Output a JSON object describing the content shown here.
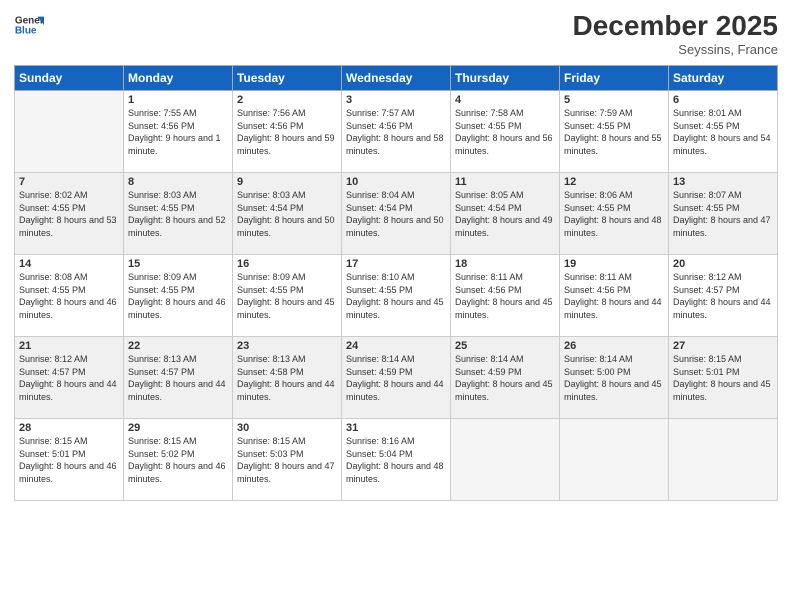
{
  "header": {
    "logo_general": "General",
    "logo_blue": "Blue",
    "month_title": "December 2025",
    "location": "Seyssins, France"
  },
  "weekdays": [
    "Sunday",
    "Monday",
    "Tuesday",
    "Wednesday",
    "Thursday",
    "Friday",
    "Saturday"
  ],
  "weeks": [
    [
      {
        "day": "",
        "empty": true
      },
      {
        "day": "1",
        "sunrise": "Sunrise: 7:55 AM",
        "sunset": "Sunset: 4:56 PM",
        "daylight": "Daylight: 9 hours and 1 minute."
      },
      {
        "day": "2",
        "sunrise": "Sunrise: 7:56 AM",
        "sunset": "Sunset: 4:56 PM",
        "daylight": "Daylight: 8 hours and 59 minutes."
      },
      {
        "day": "3",
        "sunrise": "Sunrise: 7:57 AM",
        "sunset": "Sunset: 4:56 PM",
        "daylight": "Daylight: 8 hours and 58 minutes."
      },
      {
        "day": "4",
        "sunrise": "Sunrise: 7:58 AM",
        "sunset": "Sunset: 4:55 PM",
        "daylight": "Daylight: 8 hours and 56 minutes."
      },
      {
        "day": "5",
        "sunrise": "Sunrise: 7:59 AM",
        "sunset": "Sunset: 4:55 PM",
        "daylight": "Daylight: 8 hours and 55 minutes."
      },
      {
        "day": "6",
        "sunrise": "Sunrise: 8:01 AM",
        "sunset": "Sunset: 4:55 PM",
        "daylight": "Daylight: 8 hours and 54 minutes."
      }
    ],
    [
      {
        "day": "7",
        "sunrise": "Sunrise: 8:02 AM",
        "sunset": "Sunset: 4:55 PM",
        "daylight": "Daylight: 8 hours and 53 minutes."
      },
      {
        "day": "8",
        "sunrise": "Sunrise: 8:03 AM",
        "sunset": "Sunset: 4:55 PM",
        "daylight": "Daylight: 8 hours and 52 minutes."
      },
      {
        "day": "9",
        "sunrise": "Sunrise: 8:03 AM",
        "sunset": "Sunset: 4:54 PM",
        "daylight": "Daylight: 8 hours and 50 minutes."
      },
      {
        "day": "10",
        "sunrise": "Sunrise: 8:04 AM",
        "sunset": "Sunset: 4:54 PM",
        "daylight": "Daylight: 8 hours and 50 minutes."
      },
      {
        "day": "11",
        "sunrise": "Sunrise: 8:05 AM",
        "sunset": "Sunset: 4:54 PM",
        "daylight": "Daylight: 8 hours and 49 minutes."
      },
      {
        "day": "12",
        "sunrise": "Sunrise: 8:06 AM",
        "sunset": "Sunset: 4:55 PM",
        "daylight": "Daylight: 8 hours and 48 minutes."
      },
      {
        "day": "13",
        "sunrise": "Sunrise: 8:07 AM",
        "sunset": "Sunset: 4:55 PM",
        "daylight": "Daylight: 8 hours and 47 minutes."
      }
    ],
    [
      {
        "day": "14",
        "sunrise": "Sunrise: 8:08 AM",
        "sunset": "Sunset: 4:55 PM",
        "daylight": "Daylight: 8 hours and 46 minutes."
      },
      {
        "day": "15",
        "sunrise": "Sunrise: 8:09 AM",
        "sunset": "Sunset: 4:55 PM",
        "daylight": "Daylight: 8 hours and 46 minutes."
      },
      {
        "day": "16",
        "sunrise": "Sunrise: 8:09 AM",
        "sunset": "Sunset: 4:55 PM",
        "daylight": "Daylight: 8 hours and 45 minutes."
      },
      {
        "day": "17",
        "sunrise": "Sunrise: 8:10 AM",
        "sunset": "Sunset: 4:55 PM",
        "daylight": "Daylight: 8 hours and 45 minutes."
      },
      {
        "day": "18",
        "sunrise": "Sunrise: 8:11 AM",
        "sunset": "Sunset: 4:56 PM",
        "daylight": "Daylight: 8 hours and 45 minutes."
      },
      {
        "day": "19",
        "sunrise": "Sunrise: 8:11 AM",
        "sunset": "Sunset: 4:56 PM",
        "daylight": "Daylight: 8 hours and 44 minutes."
      },
      {
        "day": "20",
        "sunrise": "Sunrise: 8:12 AM",
        "sunset": "Sunset: 4:57 PM",
        "daylight": "Daylight: 8 hours and 44 minutes."
      }
    ],
    [
      {
        "day": "21",
        "sunrise": "Sunrise: 8:12 AM",
        "sunset": "Sunset: 4:57 PM",
        "daylight": "Daylight: 8 hours and 44 minutes."
      },
      {
        "day": "22",
        "sunrise": "Sunrise: 8:13 AM",
        "sunset": "Sunset: 4:57 PM",
        "daylight": "Daylight: 8 hours and 44 minutes."
      },
      {
        "day": "23",
        "sunrise": "Sunrise: 8:13 AM",
        "sunset": "Sunset: 4:58 PM",
        "daylight": "Daylight: 8 hours and 44 minutes."
      },
      {
        "day": "24",
        "sunrise": "Sunrise: 8:14 AM",
        "sunset": "Sunset: 4:59 PM",
        "daylight": "Daylight: 8 hours and 44 minutes."
      },
      {
        "day": "25",
        "sunrise": "Sunrise: 8:14 AM",
        "sunset": "Sunset: 4:59 PM",
        "daylight": "Daylight: 8 hours and 45 minutes."
      },
      {
        "day": "26",
        "sunrise": "Sunrise: 8:14 AM",
        "sunset": "Sunset: 5:00 PM",
        "daylight": "Daylight: 8 hours and 45 minutes."
      },
      {
        "day": "27",
        "sunrise": "Sunrise: 8:15 AM",
        "sunset": "Sunset: 5:01 PM",
        "daylight": "Daylight: 8 hours and 45 minutes."
      }
    ],
    [
      {
        "day": "28",
        "sunrise": "Sunrise: 8:15 AM",
        "sunset": "Sunset: 5:01 PM",
        "daylight": "Daylight: 8 hours and 46 minutes."
      },
      {
        "day": "29",
        "sunrise": "Sunrise: 8:15 AM",
        "sunset": "Sunset: 5:02 PM",
        "daylight": "Daylight: 8 hours and 46 minutes."
      },
      {
        "day": "30",
        "sunrise": "Sunrise: 8:15 AM",
        "sunset": "Sunset: 5:03 PM",
        "daylight": "Daylight: 8 hours and 47 minutes."
      },
      {
        "day": "31",
        "sunrise": "Sunrise: 8:16 AM",
        "sunset": "Sunset: 5:04 PM",
        "daylight": "Daylight: 8 hours and 48 minutes."
      },
      {
        "day": "",
        "empty": true
      },
      {
        "day": "",
        "empty": true
      },
      {
        "day": "",
        "empty": true
      }
    ]
  ]
}
